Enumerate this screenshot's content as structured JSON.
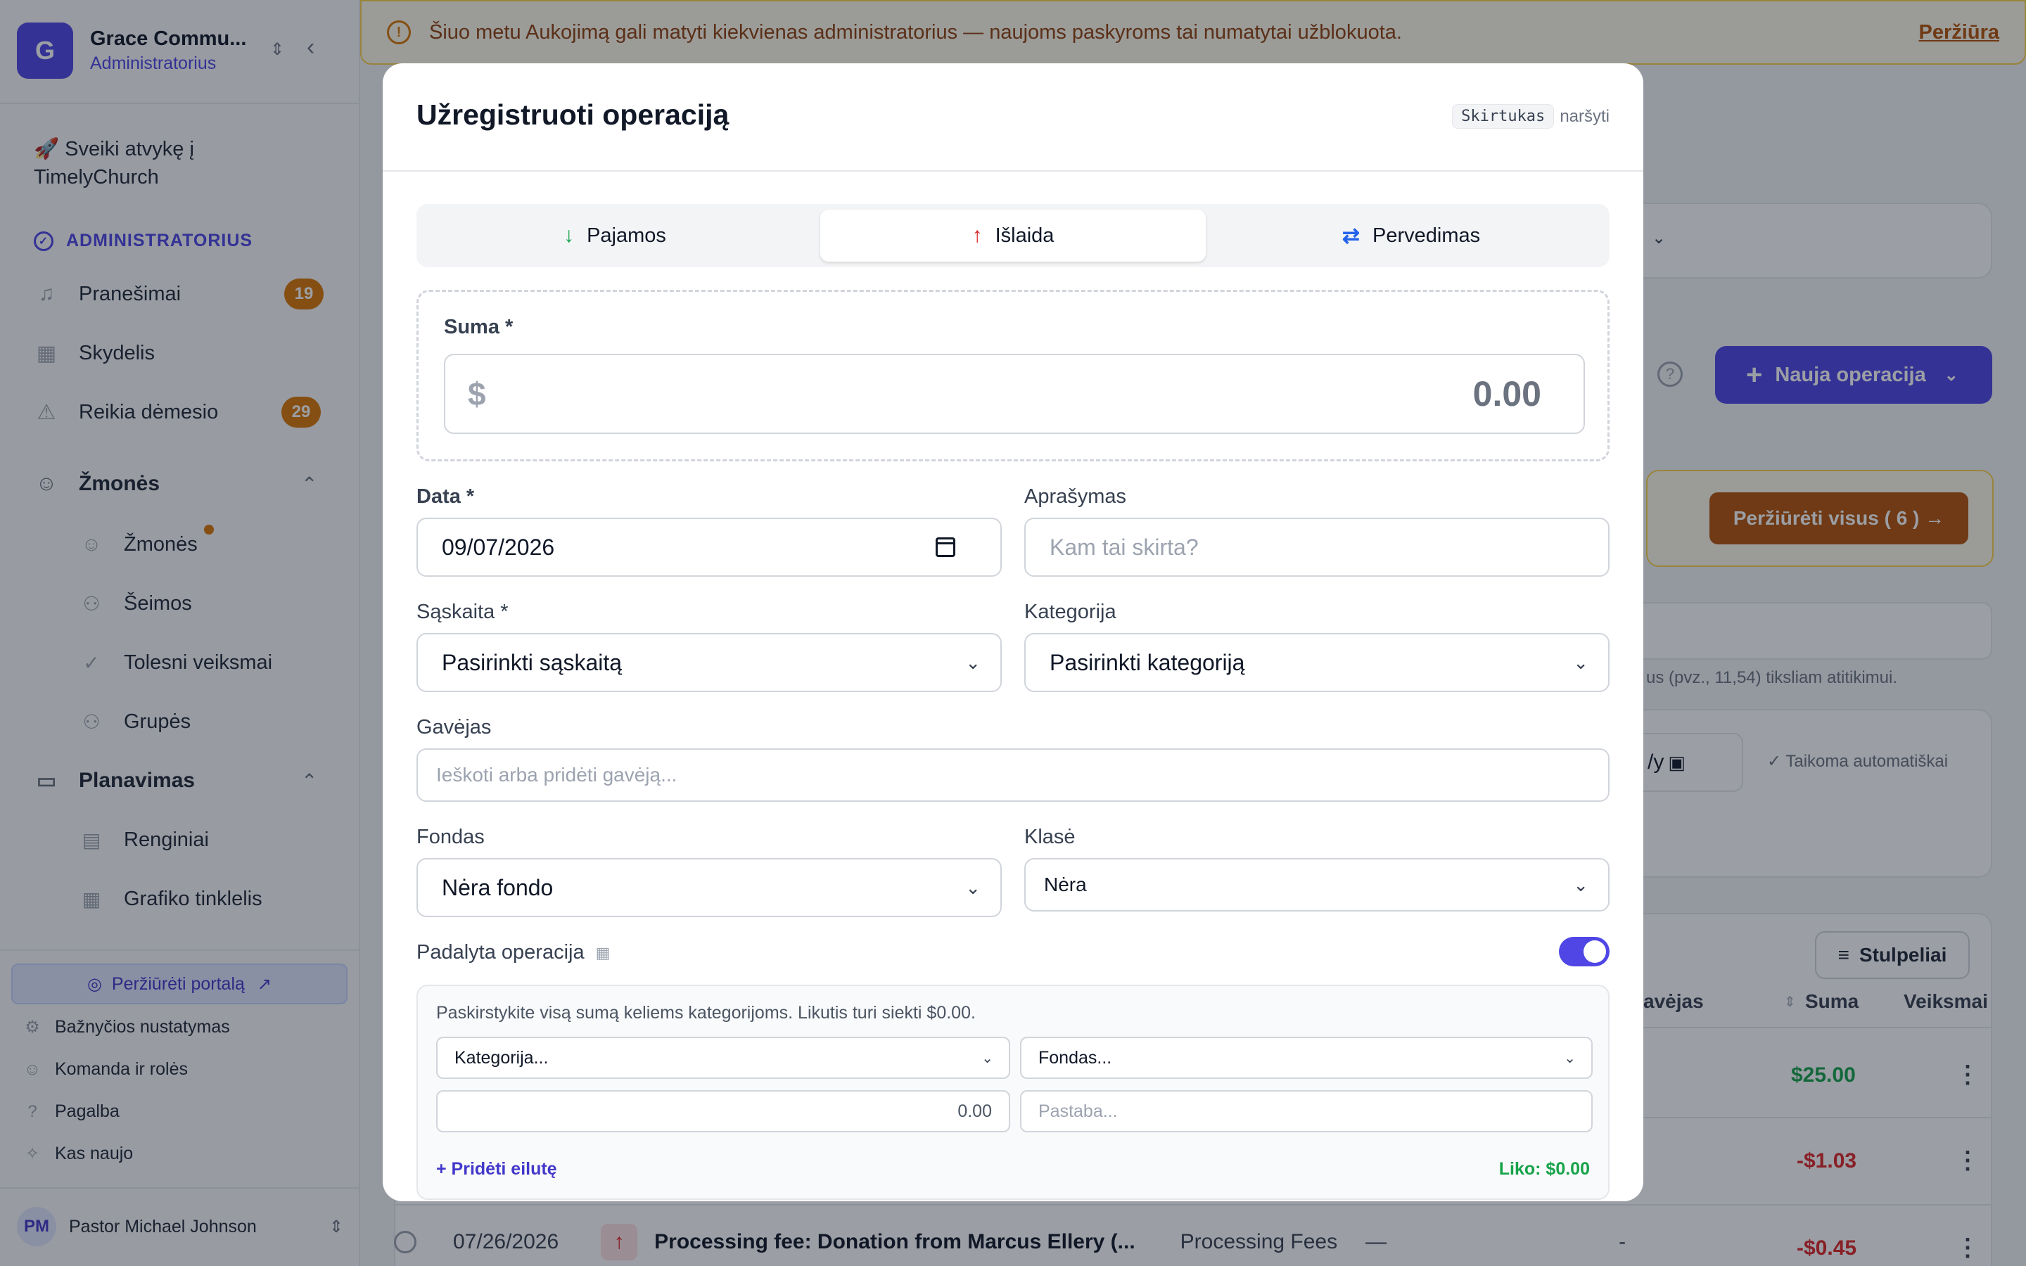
{
  "sidebar": {
    "org_initial": "G",
    "org_name": "Grace Commu...",
    "org_role": "Administratorius",
    "welcome": "🚀 Sveiki atvykę į TimelyChurch",
    "admin_section": "ADMINISTRATORIUS",
    "items": [
      {
        "label": "Pranešimai",
        "badge": "19"
      },
      {
        "label": "Skydelis"
      },
      {
        "label": "Reikia dėmesio",
        "badge": "29"
      }
    ],
    "people_group": "Žmonės",
    "people_items": [
      "Žmonės",
      "Šeimos",
      "Tolesni veiksmai",
      "Grupės"
    ],
    "planning_group": "Planavimas",
    "planning_items": [
      "Renginiai",
      "Grafiko tinklelis"
    ],
    "portal_button": "Peržiūrėti portalą",
    "footer_items": [
      "Bažnyčios nustatymas",
      "Komanda ir rolės",
      "Pagalba",
      "Kas naujo"
    ],
    "user_initials": "PM",
    "user_name": "Pastor Michael Johnson"
  },
  "banner": {
    "text": "Šiuo metu Aukojimą gali matyti kiekvienas administratorius — naujoms paskyroms tai numatytai užblokuota.",
    "link": "Peržiūra"
  },
  "background": {
    "new_op_button": "Nauja operacija",
    "view_all_button": "Peržiūrėti visus ( 6 ) →",
    "hint_text": "us (pvz., 11,54) tiksliam atitikimui.",
    "date_fragment": "/y",
    "auto_text": "✓ Taikoma automatiškai",
    "columns_button": "Stulpeliai",
    "col_payee": "avėjas",
    "col_amount": "Suma",
    "col_actions": "Veiksmai",
    "amounts": [
      "$25.00",
      "-$1.03",
      "-$0.45"
    ],
    "row3_date": "07/26/2026",
    "row3_desc": "Processing fee: Donation from Marcus Ellery (...",
    "row3_cat": "Processing Fees",
    "row3_dash1": "—",
    "row3_dash2": "-"
  },
  "modal": {
    "title": "Užregistruoti operaciją",
    "kbd_key": "Skirtukas",
    "kbd_hint": "naršyti",
    "tabs": [
      {
        "label": "Pajamos",
        "icon": "arrow-down-icon"
      },
      {
        "label": "Išlaida",
        "icon": "arrow-up-icon"
      },
      {
        "label": "Pervedimas",
        "icon": "transfer-icon"
      }
    ],
    "amount_label": "Suma *",
    "currency": "$",
    "amount_value": "0.00",
    "date_label": "Data *",
    "date_value": "09/07/2026",
    "desc_label": "Aprašymas",
    "desc_placeholder": "Kam tai skirta?",
    "account_label": "Sąskaita *",
    "account_value": "Pasirinkti sąskaitą",
    "category_label": "Kategorija",
    "category_value": "Pasirinkti kategoriją",
    "payee_label": "Gavėjas",
    "payee_placeholder": "Ieškoti arba pridėti gavėją...",
    "fund_label": "Fondas",
    "fund_value": "Nėra fondo",
    "class_label": "Klasė",
    "class_value": "Nėra",
    "split_label": "Padalyta operacija",
    "split_on": true,
    "split_hint": "Paskirstykite visą sumą keliems kategorijoms. Likutis turi siekti $0.00.",
    "split_category": "Kategorija...",
    "split_fund": "Fondas...",
    "split_amount": "0.00",
    "split_note_placeholder": "Pastaba...",
    "add_line": "+ Pridėti eilutę",
    "remaining": "Liko: $0.00"
  },
  "colors": {
    "accent": "#4f46e5",
    "warning": "#d97706",
    "income": "#16a34a",
    "expense": "#dc2626",
    "transfer": "#2563eb"
  }
}
